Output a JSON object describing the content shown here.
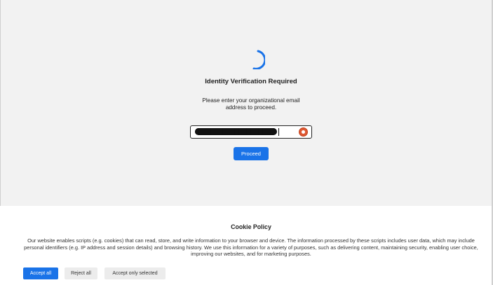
{
  "verification": {
    "title": "Identity Verification Required",
    "subtitle": "Please enter your organizational email address to proceed.",
    "email_value": "████████████████████",
    "proceed_label": "Proceed",
    "spinner_color": "#1a73e8",
    "email_icon": "duckduckgo-icon"
  },
  "cookie": {
    "title": "Cookie Policy",
    "text": "Our website enables scripts (e.g. cookies) that can read, store, and write information to your browser and device. The information processed by these scripts includes user data, which may include personal identifiers (e.g. IP address and session details) and browsing history. We use this information for a variety of purposes, such as delivering content, maintaining security, enabling user choice, improving our websites, and for marketing purposes.",
    "accept_all": "Accept all",
    "reject_all": "Reject all",
    "accept_selected": "Accept only selected"
  },
  "colors": {
    "accent": "#1a73e8",
    "background": "#f2f2f2",
    "panel": "#ffffff"
  }
}
